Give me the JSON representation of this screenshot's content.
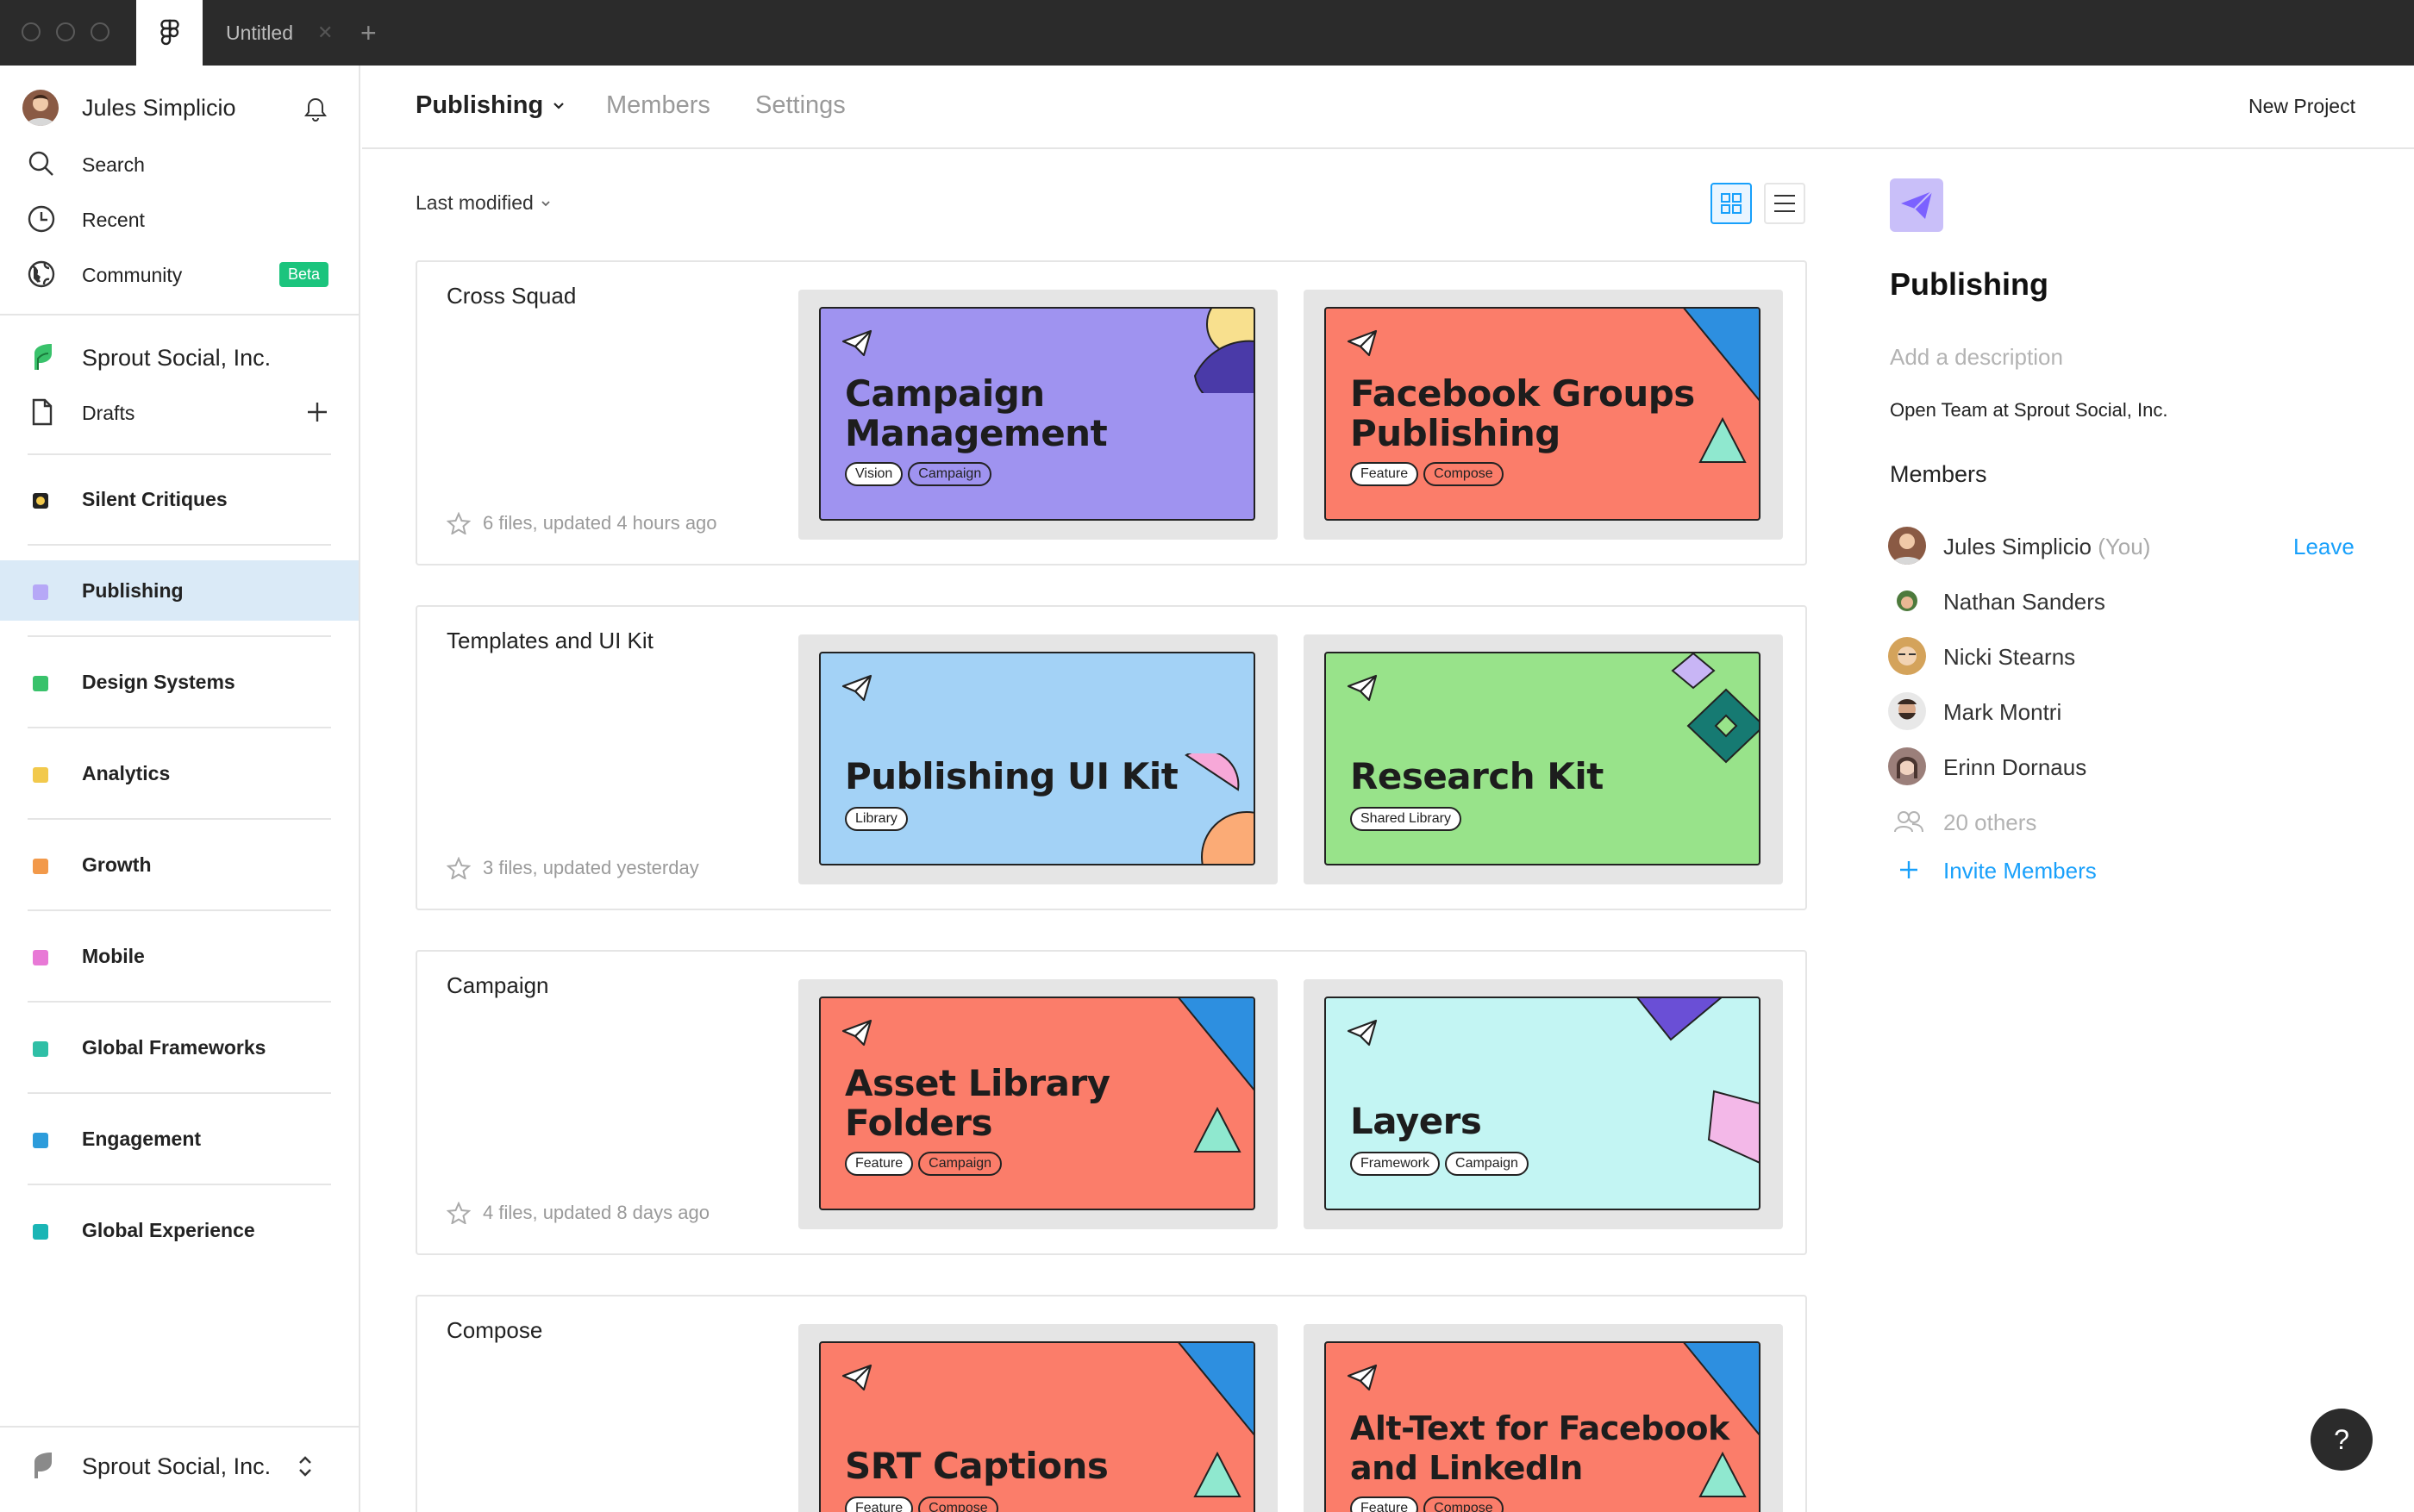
{
  "titlebar": {
    "tab_title": "Untitled"
  },
  "sidebar": {
    "user_name": "Jules Simplicio",
    "search": "Search",
    "recent": "Recent",
    "community": "Community",
    "beta_badge": "Beta",
    "org_name": "Sprout Social, Inc.",
    "drafts": "Drafts",
    "teams": [
      {
        "label": "Silent Critiques",
        "color": "#f2c94c"
      },
      {
        "label": "Publishing",
        "color": "#8e7cf0"
      },
      {
        "label": "Design Systems",
        "color": "#39c26b"
      },
      {
        "label": "Analytics",
        "color": "#f2c94c"
      },
      {
        "label": "Growth",
        "color": "#f2994a"
      },
      {
        "label": "Mobile",
        "color": "#e879d6"
      },
      {
        "label": "Global Frameworks",
        "color": "#2fbfa6"
      },
      {
        "label": "Engagement",
        "color": "#2d9cdb"
      },
      {
        "label": "Global Experience",
        "color": "#1ab5b5"
      }
    ],
    "footer_org": "Sprout Social, Inc."
  },
  "topbar": {
    "team_name": "Publishing",
    "members_tab": "Members",
    "settings_tab": "Settings",
    "new_project": "New Project"
  },
  "toolbar": {
    "sort_label": "Last modified"
  },
  "projects": [
    {
      "title": "Cross Squad",
      "meta": "6 files, updated 4 hours ago",
      "files": [
        {
          "title_line1": "Campaign",
          "title_line2": "Management",
          "tags": [
            "Vision",
            "Campaign"
          ],
          "bg": "#9f93f0"
        },
        {
          "title_line1": "Facebook Groups",
          "title_line2": "Publishing",
          "tags": [
            "Feature",
            "Compose"
          ],
          "bg": "#fb7d6a"
        }
      ]
    },
    {
      "title": "Templates and UI Kit",
      "meta": "3 files, updated yesterday",
      "files": [
        {
          "title_line1": "",
          "title_line2": "Publishing UI Kit",
          "tags": [
            "Library"
          ],
          "bg": "#a3d2f6"
        },
        {
          "title_line1": "",
          "title_line2": "Research Kit",
          "tags": [
            "Shared Library"
          ],
          "bg": "#98e38a"
        }
      ]
    },
    {
      "title": "Campaign",
      "meta": "4 files, updated 8 days ago",
      "files": [
        {
          "title_line1": "Asset Library",
          "title_line2": "Folders",
          "tags": [
            "Feature",
            "Campaign"
          ],
          "bg": "#fb7d6a"
        },
        {
          "title_line1": "",
          "title_line2": "Layers",
          "tags": [
            "Framework",
            "Campaign"
          ],
          "bg": "#c3f5f3"
        }
      ]
    },
    {
      "title": "Compose",
      "meta": "",
      "files": [
        {
          "title_line1": "",
          "title_line2": "SRT Captions",
          "tags": [
            "Feature",
            "Compose"
          ],
          "bg": "#fb7d6a"
        },
        {
          "title_line1": "Alt-Text for Facebook",
          "title_line2": "and LinkedIn",
          "tags": [
            "Feature",
            "Compose"
          ],
          "bg": "#fb7d6a"
        }
      ]
    }
  ],
  "panel": {
    "team_name": "Publishing",
    "description_placeholder": "Add a description",
    "team_info": "Open Team at Sprout Social, Inc.",
    "members_heading": "Members",
    "members": [
      {
        "name": "Jules Simplicio",
        "suffix": "(You)",
        "action": "Leave",
        "avatar_color": "#8a5a44"
      },
      {
        "name": "Nathan Sanders",
        "suffix": "",
        "action": "",
        "avatar_color": "#4d7a3c"
      },
      {
        "name": "Nicki Stearns",
        "suffix": "",
        "action": "",
        "avatar_color": "#d4a35b"
      },
      {
        "name": "Mark Montri",
        "suffix": "",
        "action": "",
        "avatar_color": "#5a4a40"
      },
      {
        "name": "Erinn Dornaus",
        "suffix": "",
        "action": "",
        "avatar_color": "#9b7f7a"
      }
    ],
    "others": "20 others",
    "invite": "Invite Members"
  },
  "help_label": "?"
}
